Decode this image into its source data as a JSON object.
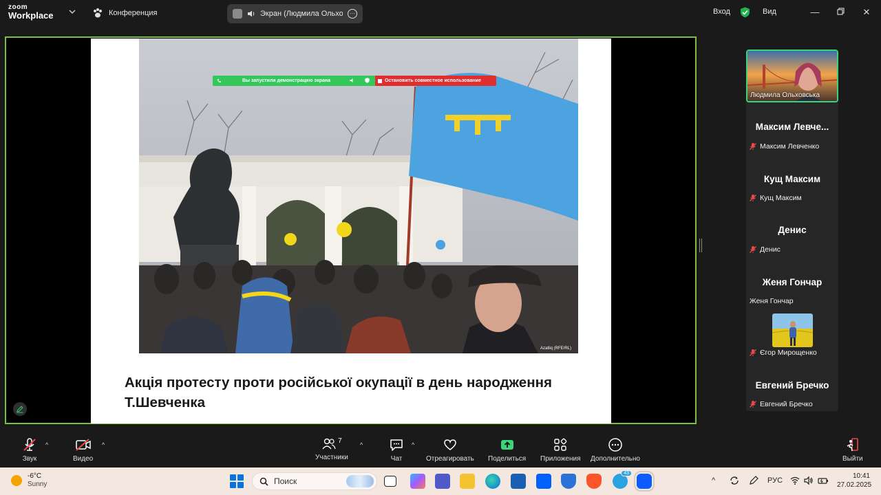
{
  "app": {
    "logo_top": "zoom",
    "logo_bottom": "Workplace",
    "meeting_label": "Конференция",
    "screen_share_pill": "Экран (Людмила Ольховська)",
    "sign_in": "Вход",
    "view": "Вид"
  },
  "share_banner": {
    "status": "Вы запустили демонстрацию экрана",
    "stop": "Остановить совместное использование"
  },
  "slide": {
    "photo_credit": "Azatliq (RFE/RL)",
    "caption": "Акція протесту проти російської окупації в день народження Т.Шевченка"
  },
  "participants": [
    {
      "big": "",
      "small": "Людмила Ольховська",
      "video": true
    },
    {
      "big": "Максим Левче...",
      "small": "Максим Левченко"
    },
    {
      "big": "Кущ Максим",
      "small": "Кущ Максим"
    },
    {
      "big": "Денис",
      "small": "Денис"
    },
    {
      "big": "Женя Гончар",
      "small": "Женя Гончар"
    },
    {
      "big": "",
      "small": "Єгор Мирощенко",
      "video": true
    },
    {
      "big": "Евгений Бречко",
      "small": "Евгений Бречко"
    }
  ],
  "toolbar": {
    "audio": "Звук",
    "video": "Видео",
    "participants": "Участники",
    "participants_count": "7",
    "chat": "Чат",
    "react": "Отреагировать",
    "share": "Поделиться",
    "apps": "Приложения",
    "more": "Дополнительно",
    "leave": "Выйти"
  },
  "taskbar": {
    "temp": "-6°C",
    "weather": "Sunny",
    "search_placeholder": "Поиск",
    "lang": "РУС",
    "time": "10:41",
    "date": "27.02.2025",
    "telegram_badge": "43"
  },
  "colors": {
    "active_speaker_border": "#7ac143",
    "share_green": "#34c759",
    "share_red": "#e02e2e",
    "zoom_blue": "#0b5cff"
  }
}
